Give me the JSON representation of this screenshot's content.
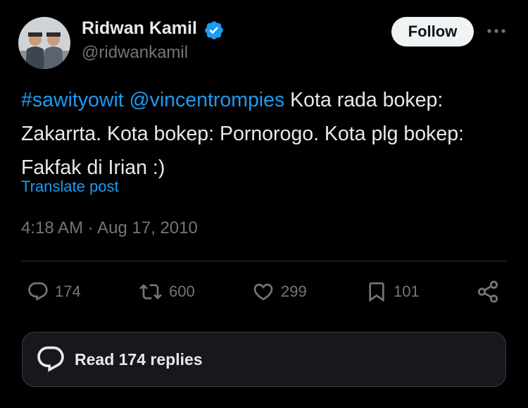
{
  "author": {
    "display_name": "Ridwan Kamil",
    "handle": "@ridwankamil",
    "verified": true,
    "verified_color": "#1d9bf0"
  },
  "header": {
    "follow_label": "Follow",
    "more_icon": "more-horizontal-icon"
  },
  "tweet": {
    "hashtag": "#sawityowit",
    "mention": "@vincentrompies",
    "body": " Kota rada bokep: Zakarrta. Kota bokep: Pornorogo. Kota plg bokep: Fakfak di Irian :)",
    "translate_label": "Translate post",
    "timestamp": "4:18 AM · Aug 17, 2010",
    "link_color": "#1d9bf0"
  },
  "actions": {
    "reply": {
      "icon": "reply-icon",
      "count": "174"
    },
    "repost": {
      "icon": "repost-icon",
      "count": "600"
    },
    "like": {
      "icon": "heart-icon",
      "count": "299"
    },
    "bookmark": {
      "icon": "bookmark-icon",
      "count": "101"
    },
    "share": {
      "icon": "share-icon"
    }
  },
  "replies": {
    "label": "Read 174 replies",
    "icon": "reply-bubble-icon"
  },
  "colors": {
    "background": "#000000",
    "text": "#e7e9ea",
    "muted": "#71767b",
    "accent": "#1d9bf0",
    "divider": "#2f3336"
  }
}
